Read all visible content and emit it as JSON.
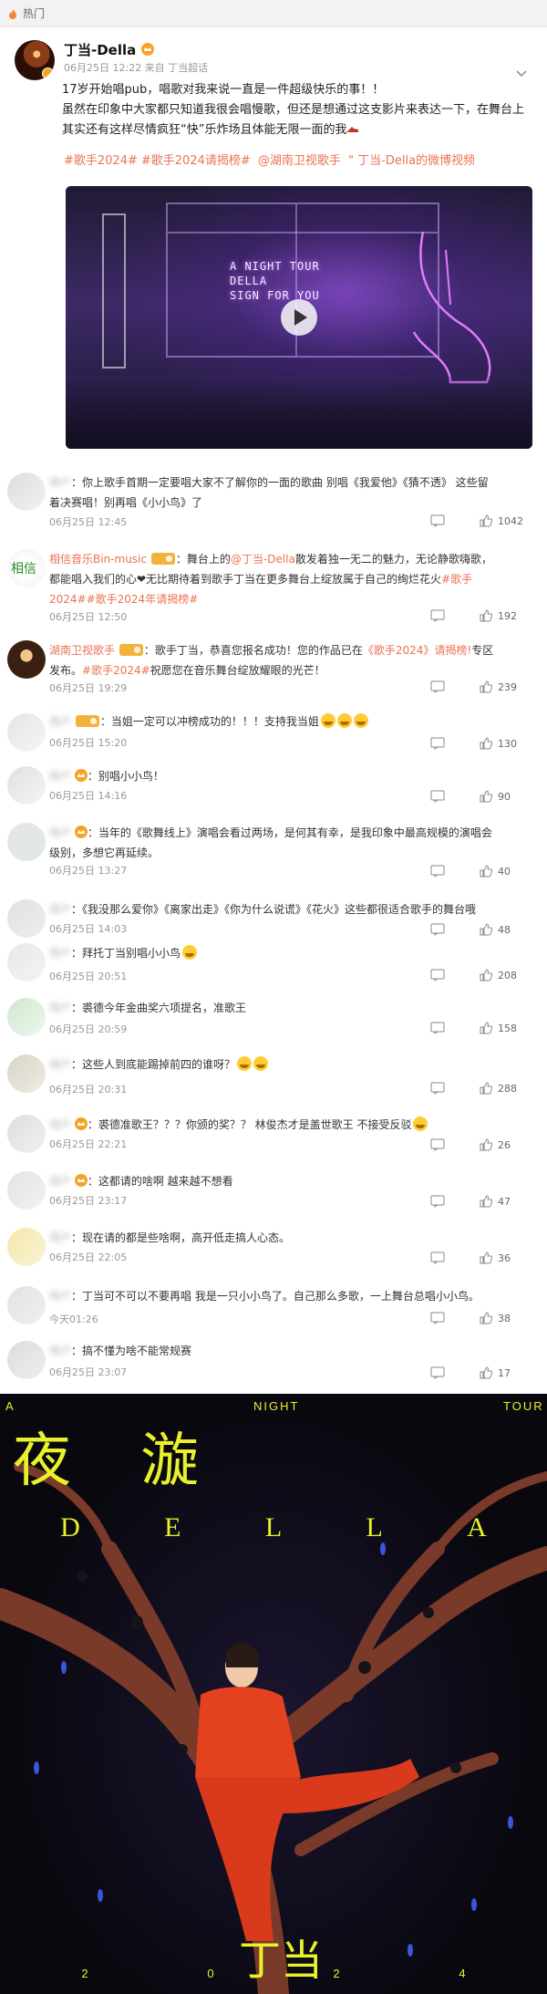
{
  "header": {
    "hot_label": "热门"
  },
  "post": {
    "author": "丁当-Della",
    "meta": "06月25日 12:22  来自 丁当超话",
    "paragraphs": [
      "17岁开始唱pub，唱歌对我来说一直是一件超级快乐的事！！",
      "虽然在印象中大家都只知道我很会唱慢歌，但还是想通过这支影片来表达一下，在舞台上其实还有这样尽情疯狂“快”乐炸场且体能无限一面的我"
    ],
    "topics": [
      "#歌手2024#",
      "#歌手2024请揭榜#",
      "@湖南卫视歌手",
      "\" 丁当-Della的微博视频"
    ],
    "video_sign": [
      "A NIGHT TOUR",
      "DELLA",
      "SIGN FOR YOU"
    ]
  },
  "comments": [
    {
      "user": "用户",
      "text": "：你上歌手首期一定要唱大家不了解你的一面的歌曲 别唱《我爱他》《猜不透》 这些留着决赛唱！别再唱《小小鸟》了",
      "time": "06月25日 12:45",
      "likes": "1042"
    },
    {
      "user": "相信音乐Bin-music",
      "text": "：舞台上的",
      "mention": "@丁当-Della",
      "text2": "散发着独一无二的魅力，无论静歌嗨歌，都能唱入我们的心❤无比期待着到歌手丁当在更多舞台上绽放属于自己的绚烂花火",
      "tags": "#歌手2024##歌手2024年请揭榜#",
      "time": "06月25日 12:50",
      "likes": "192"
    },
    {
      "user": "湖南卫视歌手",
      "text": "：歌手丁当，恭喜您报名成功！您的作品已在",
      "tags": "《歌手2024》请揭榜!",
      "text2": "专区发布。",
      "tags2": "#歌手2024#",
      "text3": "祝愿您在音乐舞台绽放耀眼的光芒！",
      "time": "06月25日 19:29",
      "likes": "239"
    },
    {
      "user": "用户",
      "text": "：当姐一定可以冲榜成功的！！！支持我当姐",
      "time": "06月25日 15:20",
      "likes": "130"
    },
    {
      "user": "用户",
      "text": "：别唱小小鸟！",
      "time": "06月25日 14:16",
      "likes": "90"
    },
    {
      "user": "用户",
      "text": "：当年的《歌舞线上》演唱会看过两场，是何其有幸，是我印象中最高规模的演唱会级别，多想它再延续。",
      "time": "06月25日 13:27",
      "likes": "40"
    },
    {
      "user": "用户",
      "text": "：《我没那么爱你》《离家出走》《你为什么说谎》《花火》这些都很适合歌手的舞台哦",
      "time": "06月25日 14:03",
      "likes": "48"
    },
    {
      "user": "用户",
      "text": "：拜托丁当别唱小小鸟",
      "time": "06月25日 20:51",
      "likes": "208"
    },
    {
      "user": "用户",
      "text": "：裘德今年金曲奖六项提名，准歌王",
      "time": "06月25日 20:59",
      "likes": "158"
    },
    {
      "user": "用户",
      "text": "：这些人到底能踢掉前四的谁呀？",
      "time": "06月25日 20:31",
      "likes": "288"
    },
    {
      "user": "用户",
      "text": "：裘德准歌王？？？你颁的奖？？ 林俊杰才是盖世歌王 不接受反驳",
      "time": "06月25日 22:21",
      "likes": "26"
    },
    {
      "user": "用户",
      "text": "：这都请的啥啊 越来越不想看",
      "time": "06月25日 23:17",
      "likes": "47"
    },
    {
      "user": "用户",
      "text": "：现在请的都是些啥啊，高开低走搞人心态。",
      "time": "06月25日 22:05",
      "likes": "36"
    },
    {
      "user": "用户",
      "text": "：丁当可不可以不要再唱 我是一只小小鸟了。自己那么多歌，一上舞台总唱小小鸟。",
      "time": "今天01:26",
      "likes": "38"
    },
    {
      "user": "用户",
      "text": "：搞不懂为啥不能常规赛",
      "time": "06月25日 23:07",
      "likes": "17"
    }
  ],
  "poster": {
    "top_words": [
      "A",
      "NIGHT",
      "TOUR"
    ],
    "big_title": "夜 漩",
    "della_letters": [
      "D",
      "E",
      "L",
      "L",
      "A"
    ],
    "name_char": "丁当",
    "year_digits": [
      "2",
      "0",
      "2",
      "4"
    ]
  },
  "colors": {
    "accent": "#eb7350",
    "poster_yellow": "#e8f12a"
  }
}
